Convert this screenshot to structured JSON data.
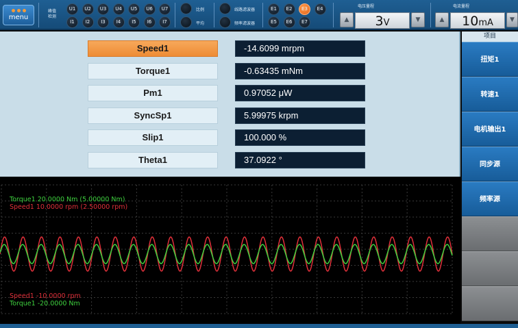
{
  "toolbar": {
    "menu_label": "menu",
    "peak_label_line1": "峰值",
    "peak_label_line2": "检测",
    "u_buttons": [
      "U1",
      "U2",
      "U3",
      "U4",
      "U5",
      "U6",
      "U7"
    ],
    "i_buttons": [
      "I1",
      "I2",
      "I3",
      "I4",
      "I5",
      "I6",
      "I7"
    ],
    "ratio_label": "比例",
    "average_label": "平均",
    "line_filter_label": "线路滤波器",
    "freq_filter_label": "频率滤波器",
    "e_buttons_top": [
      "E1",
      "E2",
      "E3",
      "E4"
    ],
    "e_buttons_bottom": [
      "E5",
      "E6",
      "E7"
    ],
    "active_e_button": "E3",
    "voltage_range": {
      "label": "电压量程",
      "value": "3",
      "unit": "V"
    },
    "current_range": {
      "label": "电流量程",
      "value": "10",
      "unit": "mA"
    }
  },
  "measurements": [
    {
      "name": "Speed1",
      "value": "-14.6099 mrpm",
      "selected": true
    },
    {
      "name": "Torque1",
      "value": "-0.63435 mNm",
      "selected": false
    },
    {
      "name": "Pm1",
      "value": "0.97052 μW",
      "selected": false
    },
    {
      "name": "SyncSp1",
      "value": "5.99975 krpm",
      "selected": false
    },
    {
      "name": "Slip1",
      "value": "100.000  %",
      "selected": false
    },
    {
      "name": "Theta1",
      "value": "37.0922  °",
      "selected": false
    }
  ],
  "side_menu": {
    "header": "项目",
    "items": [
      {
        "label": "扭矩1",
        "enabled": true
      },
      {
        "label": "转速1",
        "enabled": true
      },
      {
        "label": "电机输出1",
        "enabled": true
      },
      {
        "label": "同步源",
        "enabled": true
      },
      {
        "label": "频率源",
        "enabled": true
      },
      {
        "label": "",
        "enabled": false
      },
      {
        "label": "",
        "enabled": false
      },
      {
        "label": "",
        "enabled": false
      }
    ]
  },
  "waveform": {
    "labels_top": [
      {
        "text": "Torque1  20.0000 Nm (5.00000 Nm)",
        "color": "#3fd23f"
      },
      {
        "text": "Speed1  10.0000 rpm (2.50000 rpm)",
        "color": "#e0303a"
      }
    ],
    "labels_bottom": [
      {
        "text": "Speed1  -10.0000 rpm",
        "color": "#e0303a"
      },
      {
        "text": "Torque1  -20.0000 Nm",
        "color": "#3fd23f"
      }
    ],
    "torque_color": "#3fd23f",
    "speed_color": "#e0303a",
    "cycles": 24.5
  }
}
